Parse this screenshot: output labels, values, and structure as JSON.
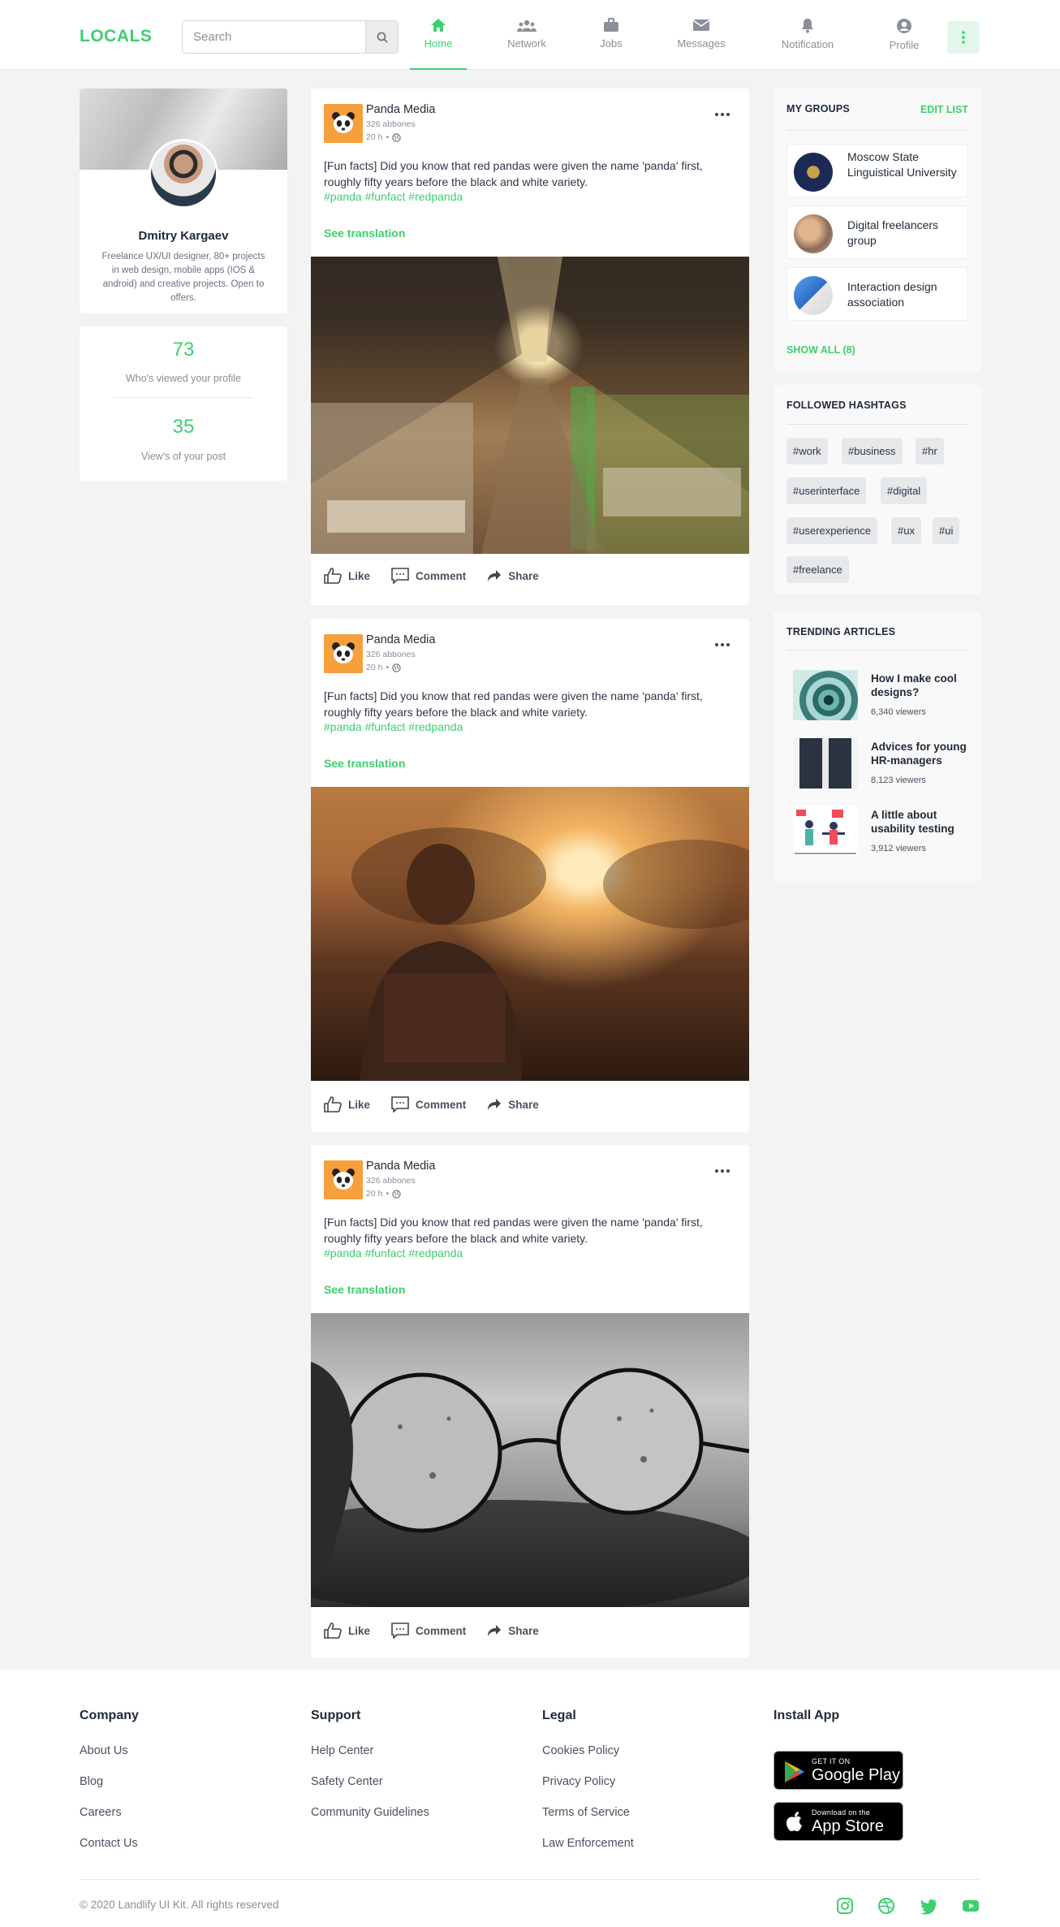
{
  "brand": {
    "name": "LOCALS",
    "accent": "#3ecf6f"
  },
  "search": {
    "placeholder": "Search"
  },
  "nav": {
    "items": [
      {
        "label": "Home",
        "icon": "home-icon",
        "active": true
      },
      {
        "label": "Network",
        "icon": "network-icon"
      },
      {
        "label": "Jobs",
        "icon": "briefcase-icon"
      },
      {
        "label": "Messages",
        "icon": "envelope-icon"
      },
      {
        "label": "Notification",
        "icon": "bell-icon"
      },
      {
        "label": "Profile",
        "icon": "user-icon"
      }
    ]
  },
  "profile": {
    "name": "Dmitry Kargaev",
    "bio": "Freelance UX/UI designer, 80+ projects in web design, mobile apps (IOS & android) and creative projects. Open to offers.",
    "stats": [
      {
        "value": "73",
        "label": "Who's viewed your profile"
      },
      {
        "value": "35",
        "label": "View's of your post"
      }
    ]
  },
  "posts": [
    {
      "author": "Panda Media",
      "subscribers": "326 abbones",
      "time": "20 h",
      "text": "[Fun facts] Did you know that red pandas were given the name 'panda' first, roughly fifty years before the black and white variety.",
      "tags": "#panda #funfact #redpanda",
      "translate": "See translation",
      "image": "market-hall-photo"
    },
    {
      "author": "Panda Media",
      "subscribers": "326 abbones",
      "time": "20 h",
      "text": "[Fun facts] Did you know that red pandas were given the name 'panda' first, roughly fifty years before the black and white variety.",
      "tags": "#panda #funfact #redpanda",
      "translate": "See translation",
      "image": "sunset-woman-photo"
    },
    {
      "author": "Panda Media",
      "subscribers": "326 abbones",
      "time": "20 h",
      "text": "[Fun facts] Did you know that red pandas were given the name 'panda' first, roughly fifty years before the black and white variety.",
      "tags": "#panda #funfact #redpanda",
      "translate": "See translation",
      "image": "glasses-rain-photo"
    }
  ],
  "actions": {
    "like": "Like",
    "comment": "Comment",
    "share": "Share"
  },
  "groups": {
    "title": "MY GROUPS",
    "edit": "EDIT LIST",
    "items": [
      {
        "name": "Moscow State Linguistical University"
      },
      {
        "name": "Digital freelancers group"
      },
      {
        "name": "Interaction design association"
      }
    ],
    "show_all": "SHOW ALL (8)"
  },
  "hashtags": {
    "title": "FOLLOWED HASHTAGS",
    "items": [
      "#work",
      "#business",
      "#hr",
      "#userinterface",
      "#digital",
      "#userexperience",
      "#ux",
      "#ui",
      "#freelance"
    ]
  },
  "articles": {
    "title": "TRENDING ARTICLES",
    "items": [
      {
        "title": "How I make cool designs?",
        "views": "6,340 viewers"
      },
      {
        "title": "Advices for young HR-managers",
        "views": "8,123 viewers"
      },
      {
        "title": "A little about usability testing",
        "views": "3,912 viewers"
      }
    ]
  },
  "footer": {
    "company": {
      "title": "Company",
      "links": [
        "About Us",
        "Blog",
        "Careers",
        "Contact Us"
      ]
    },
    "support": {
      "title": "Support",
      "links": [
        "Help Center",
        "Safety Center",
        "Community Guidelines"
      ]
    },
    "legal": {
      "title": "Legal",
      "links": [
        "Cookies Policy",
        "Privacy Policy",
        "Terms of Service",
        "Law Enforcement"
      ]
    },
    "install": {
      "title": "Install App",
      "google_small": "GET IT ON",
      "google_big": "Google Play",
      "apple_small": "Download on the",
      "apple_big": "App Store"
    },
    "copyright": "© 2020 Landlify UI Kit. All rights reserved",
    "social": [
      "instagram-icon",
      "dribbble-icon",
      "twitter-icon",
      "youtube-icon"
    ]
  }
}
